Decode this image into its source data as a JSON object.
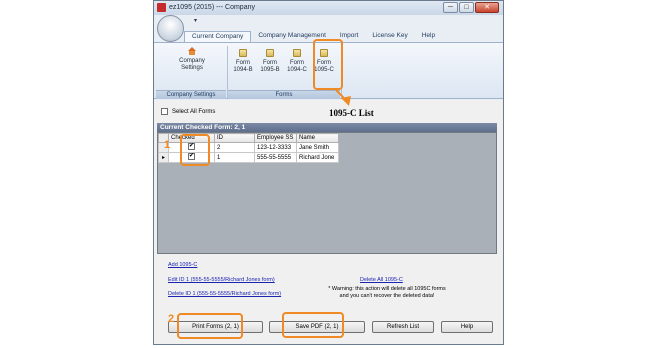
{
  "window": {
    "title": "ez1095 (2015) --- Company",
    "min_label": "─",
    "max_label": "□",
    "close_label": "✕",
    "qat_label": "▾"
  },
  "ribbon": {
    "tabs": [
      {
        "label": "Current Company",
        "active": true
      },
      {
        "label": "Company Management"
      },
      {
        "label": "Import"
      },
      {
        "label": "License Key"
      },
      {
        "label": "Help"
      }
    ],
    "company_settings": {
      "line1": "Company",
      "line2": "Settings",
      "group_label": "Company Settings"
    },
    "forms": [
      {
        "line1": "Form",
        "line2": "1094-B"
      },
      {
        "line1": "Form",
        "line2": "1095-B"
      },
      {
        "line1": "Form",
        "line2": "1094-C"
      },
      {
        "line1": "Form",
        "line2": "1095-C"
      }
    ],
    "forms_group_label": "Forms"
  },
  "content": {
    "select_all_label": "Select All Forms",
    "grid_title": "Current Checked Form: 2, 1",
    "columns": [
      "Checked",
      "ID",
      "Employee SS",
      "Name"
    ],
    "rows": [
      {
        "id": "2",
        "ss": "123-12-3333",
        "name": "Jane Smith",
        "checked": true
      },
      {
        "id": "1",
        "ss": "555-55-5555",
        "name": "Richard Jone",
        "checked": true
      }
    ],
    "links": {
      "add": "Add 1095-C",
      "edit": "Edit ID 1 (555-55-5555/Richard Jones form)",
      "delete": "Delete ID 1 (555-55-5555/Richard Jones form)",
      "delete_all": "Delete All 1095-C"
    },
    "warning": "* Warning: this action will delete all 1095C forms and you can't recover the deleted data!"
  },
  "buttons": {
    "print": "Print Forms (2, 1)",
    "save_pdf": "Save PDF (2, 1)",
    "refresh": "Refresh List",
    "help": "Help"
  },
  "annotations": {
    "caption": "1095-C List",
    "num1": "1",
    "num2": "2",
    "color": "#f08a24"
  }
}
